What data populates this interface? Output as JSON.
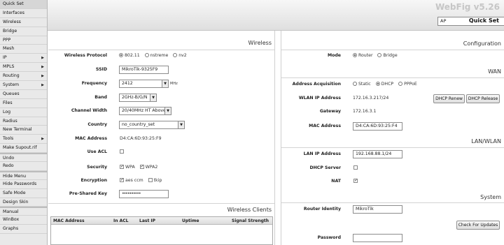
{
  "sidebar": {
    "items": [
      {
        "label": "Quick Set",
        "active": true,
        "submenu": false
      },
      {
        "label": "Interfaces",
        "submenu": false
      },
      {
        "label": "Wireless",
        "submenu": false
      },
      {
        "label": "Bridge",
        "submenu": false
      },
      {
        "label": "PPP",
        "submenu": false
      },
      {
        "label": "Mesh",
        "submenu": false
      },
      {
        "label": "IP",
        "submenu": true
      },
      {
        "label": "MPLS",
        "submenu": true
      },
      {
        "label": "Routing",
        "submenu": true
      },
      {
        "label": "System",
        "submenu": true
      },
      {
        "label": "Queues",
        "submenu": false
      },
      {
        "label": "Files",
        "submenu": false
      },
      {
        "label": "Log",
        "submenu": false
      },
      {
        "label": "Radius",
        "submenu": false
      },
      {
        "label": "New Terminal",
        "submenu": false
      },
      {
        "label": "Tools",
        "submenu": true
      },
      {
        "label": "Make Supout.rif",
        "submenu": false
      },
      {
        "label": "Undo",
        "submenu": false
      },
      {
        "label": "Redo",
        "submenu": false
      },
      {
        "label": "Hide Menu",
        "submenu": false
      },
      {
        "label": "Hide Passwords",
        "submenu": false
      },
      {
        "label": "Safe Mode",
        "submenu": false
      },
      {
        "label": "Design Skin",
        "submenu": false
      },
      {
        "label": "Manual",
        "submenu": false
      },
      {
        "label": "WinBox",
        "submenu": false
      },
      {
        "label": "Graphs",
        "submenu": false
      }
    ],
    "arrow_glyph": "▶"
  },
  "header": {
    "brand": "WebFig v5.26",
    "mode_select": "AP",
    "title": "Quick Set"
  },
  "wireless": {
    "title": "Wireless",
    "protocol": {
      "label": "Wireless Protocol",
      "options": [
        "802.11",
        "nstreme",
        "nv2"
      ],
      "selected": "802.11"
    },
    "ssid": {
      "label": "SSID",
      "value": "MikroTik-9325F9"
    },
    "frequency": {
      "label": "Frequency",
      "value": "2412",
      "unit": "MHz"
    },
    "band": {
      "label": "Band",
      "value": "2GHz-B/G/N"
    },
    "channel_width": {
      "label": "Channel Width",
      "value": "20/40MHz HT Above"
    },
    "country": {
      "label": "Country",
      "value": "no_country_set"
    },
    "mac": {
      "label": "MAC Address",
      "value": "D4:CA:6D:93:25:F9"
    },
    "use_acl": {
      "label": "Use ACL",
      "checked": false
    },
    "security": {
      "label": "Security",
      "options": [
        {
          "name": "WPA",
          "checked": true
        },
        {
          "name": "WPA2",
          "checked": true
        }
      ]
    },
    "encryption": {
      "label": "Encryption",
      "options": [
        {
          "name": "aes ccm",
          "checked": true
        },
        {
          "name": "tkip",
          "checked": false
        }
      ]
    },
    "psk": {
      "label": "Pre-Shared Key",
      "value": "••••••••••"
    }
  },
  "clients": {
    "title": "Wireless Clients",
    "columns": [
      "MAC Address",
      "In ACL",
      "Last IP",
      "Uptime",
      "Signal Strength"
    ],
    "rows": []
  },
  "config": {
    "title": "Configuration",
    "mode": {
      "label": "Mode",
      "options": [
        "Router",
        "Bridge"
      ],
      "selected": "Router"
    }
  },
  "wan": {
    "title": "WAN",
    "acquisition": {
      "label": "Address Acquisition",
      "options": [
        "Static",
        "DHCP",
        "PPPoE"
      ],
      "selected": "DHCP"
    },
    "wlan_ip": {
      "label": "WLAN IP Address",
      "value": "172.16.3.217/24"
    },
    "dhcp_renew": "DHCP Renew",
    "dhcp_release": "DHCP Release",
    "gateway": {
      "label": "Gateway",
      "value": "172.16.3.1"
    },
    "mac": {
      "label": "MAC Address",
      "value": "D4:CA:6D:93:25:F4"
    }
  },
  "lan": {
    "title": "LAN/WLAN",
    "ip": {
      "label": "LAN IP Address",
      "value": "192.168.88.1/24"
    },
    "dhcp_server": {
      "label": "DHCP Server",
      "checked": false
    },
    "nat": {
      "label": "NAT",
      "checked": true
    }
  },
  "system": {
    "title": "System",
    "identity": {
      "label": "Router Identity",
      "value": "MikroTik"
    },
    "check_updates": "Check For Updates",
    "password": {
      "label": "Password",
      "value": ""
    }
  }
}
